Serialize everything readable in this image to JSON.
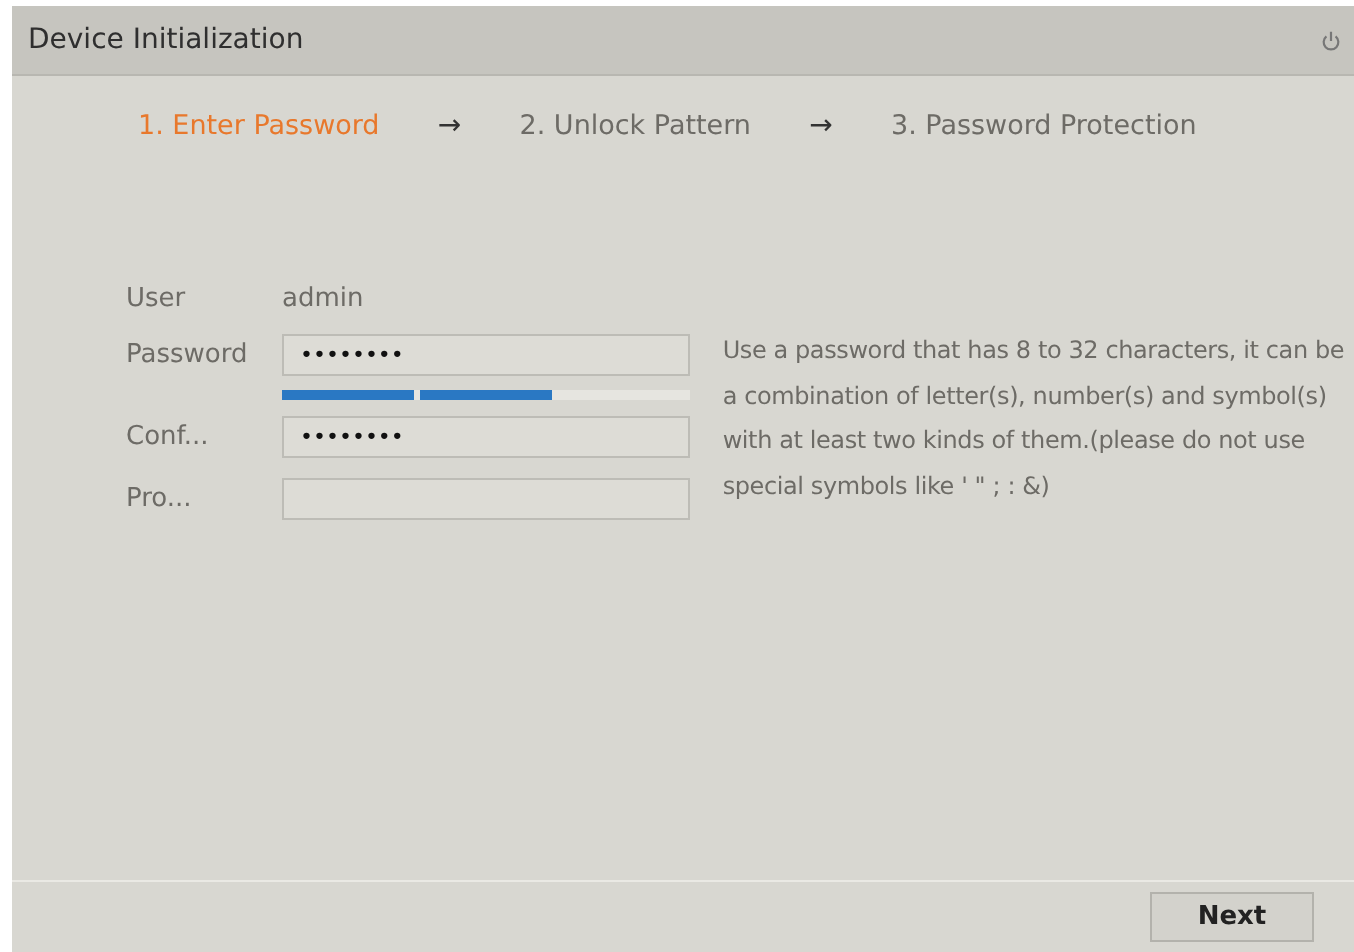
{
  "window": {
    "title": "Device Initialization"
  },
  "steps": [
    {
      "label": "1.  Enter Password",
      "selected": true
    },
    {
      "label": "2.  Unlock Pattern",
      "selected": false
    },
    {
      "label": "3.  Password Protection",
      "selected": false
    }
  ],
  "step_separator": "→",
  "form": {
    "user_label": "User",
    "user_value": "admin",
    "fields": [
      {
        "label": "Password",
        "value": "••••••••"
      },
      {
        "label": "Conf...",
        "value": "••••••••"
      },
      {
        "label": "Pro..."
      }
    ],
    "strength": {
      "level": 0.66
    }
  },
  "hint": "Use a password that has 8 to 32 characters, it can be a combination of letter(s), number(s) and symbol(s) with at least two kinds of them.(please do not use special symbols like ' \" ; : &)",
  "buttons": [
    {
      "label": "Next"
    }
  ]
}
